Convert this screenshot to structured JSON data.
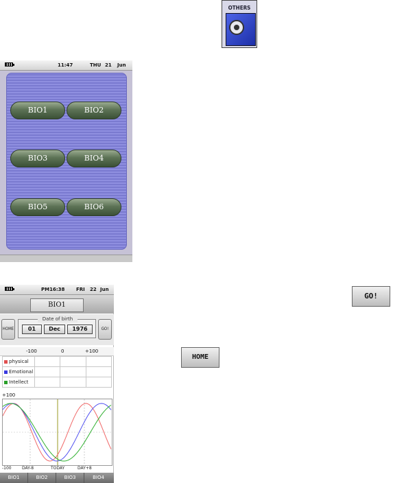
{
  "others_icon": {
    "label": "OTHERS",
    "icon": "film-reel-icon"
  },
  "screen1": {
    "status": {
      "time": "11:47",
      "day": "THU",
      "date": "21",
      "month": "Jun"
    },
    "buttons": [
      "BIO1",
      "BIO2",
      "BIO3",
      "BIO4",
      "BIO5",
      "BIO6"
    ]
  },
  "screen2": {
    "status": {
      "time": "PM16:38",
      "day": "FRI",
      "date": "22",
      "month": "Jun"
    },
    "title": "BIO1",
    "home_label": "HOME",
    "go_label": "GO!",
    "dob_label": "Date of birth",
    "dob": {
      "day": "01",
      "month": "Dec",
      "year": "1976"
    },
    "scale": {
      "left": "-100",
      "mid": "0",
      "right": "+100"
    },
    "rows": [
      {
        "label": "physical",
        "color": "#e05050"
      },
      {
        "label": "Emotional",
        "color": "#3a3ae0"
      },
      {
        "label": "Intellect",
        "color": "#2aa02a"
      }
    ],
    "chart": {
      "y_top_label": "+100",
      "y_bottom_label": "-100",
      "x_labels": [
        "DAY-8",
        "TODAY",
        "DAY+8"
      ],
      "series_colors": {
        "physical": "#f06868",
        "emotional": "#5050f0",
        "intellect": "#30b030"
      }
    },
    "tabs": [
      "BIO1",
      "BIO2",
      "BIO3",
      "BIO4"
    ]
  },
  "go_button": {
    "label": "GO!"
  },
  "home_button": {
    "label": "HOME"
  }
}
